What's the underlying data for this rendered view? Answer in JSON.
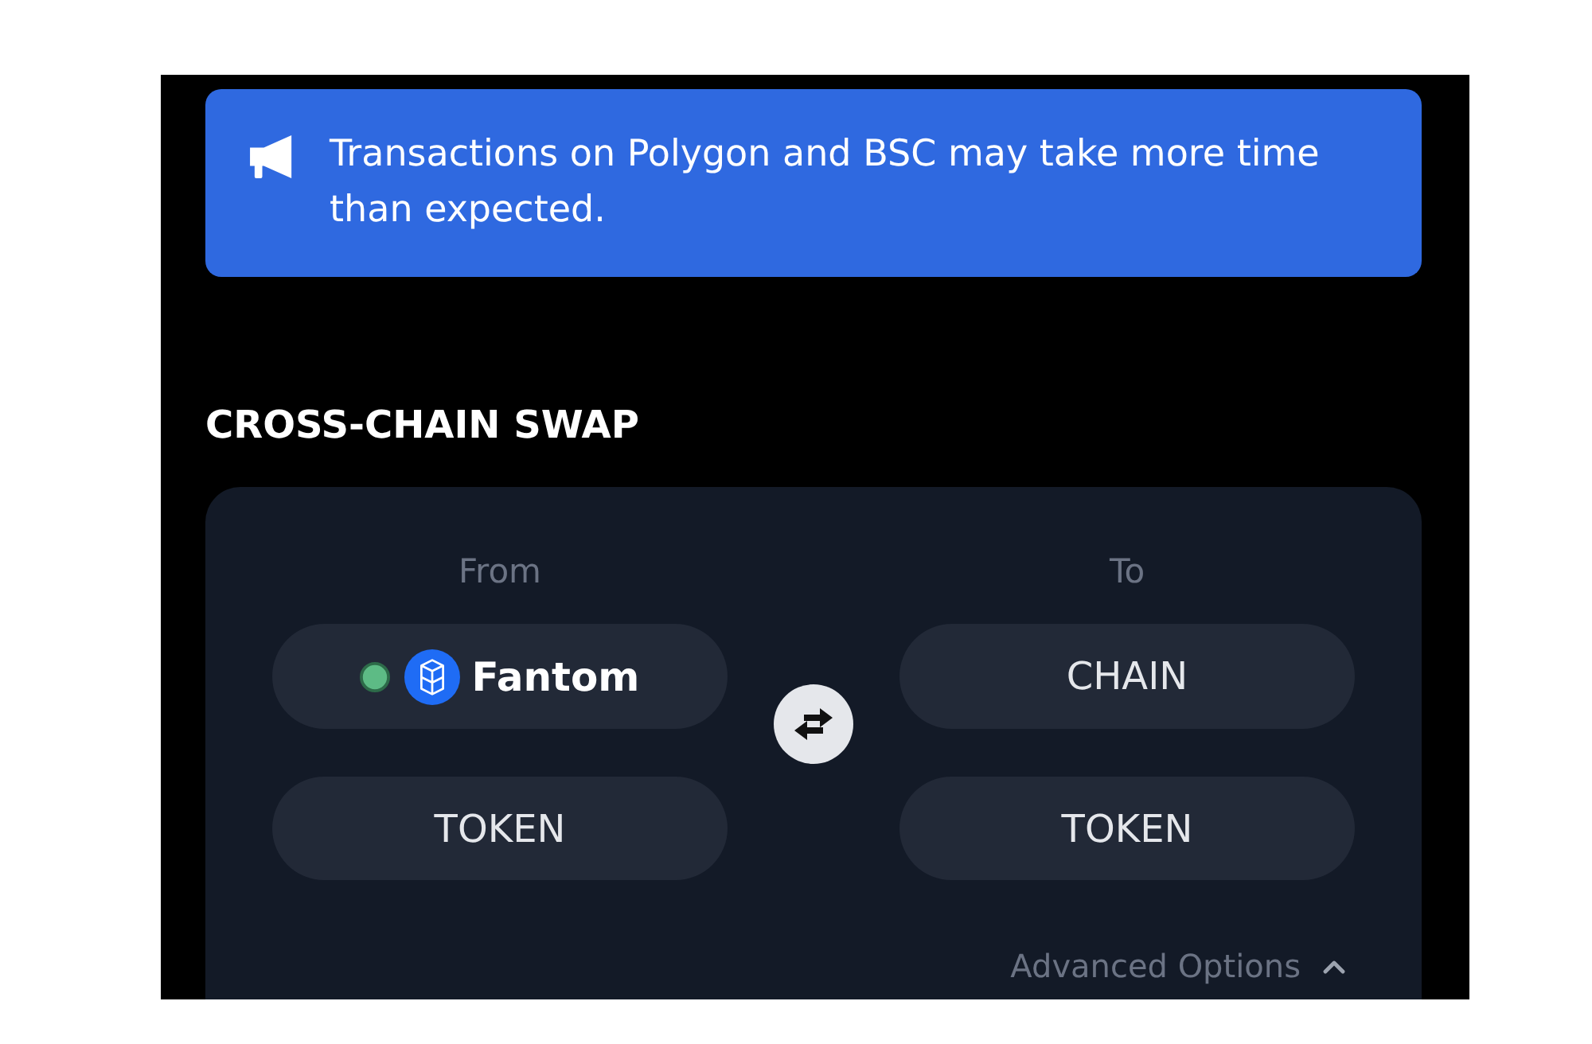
{
  "banner": {
    "text": "Transactions on Polygon and BSC may take more time than expected."
  },
  "heading": "CROSS-CHAIN SWAP",
  "swap": {
    "columns": [
      {
        "label": "From",
        "chain": {
          "label": "Fantom",
          "kind": "network",
          "connected": true
        },
        "token": {
          "label": "TOKEN",
          "kind": "placeholder"
        }
      },
      {
        "label": "To",
        "chain": {
          "label": "CHAIN",
          "kind": "placeholder",
          "connected": false
        },
        "token": {
          "label": "TOKEN",
          "kind": "placeholder"
        }
      }
    ],
    "advanced": {
      "label": "Advanced Options",
      "expanded": true
    }
  }
}
